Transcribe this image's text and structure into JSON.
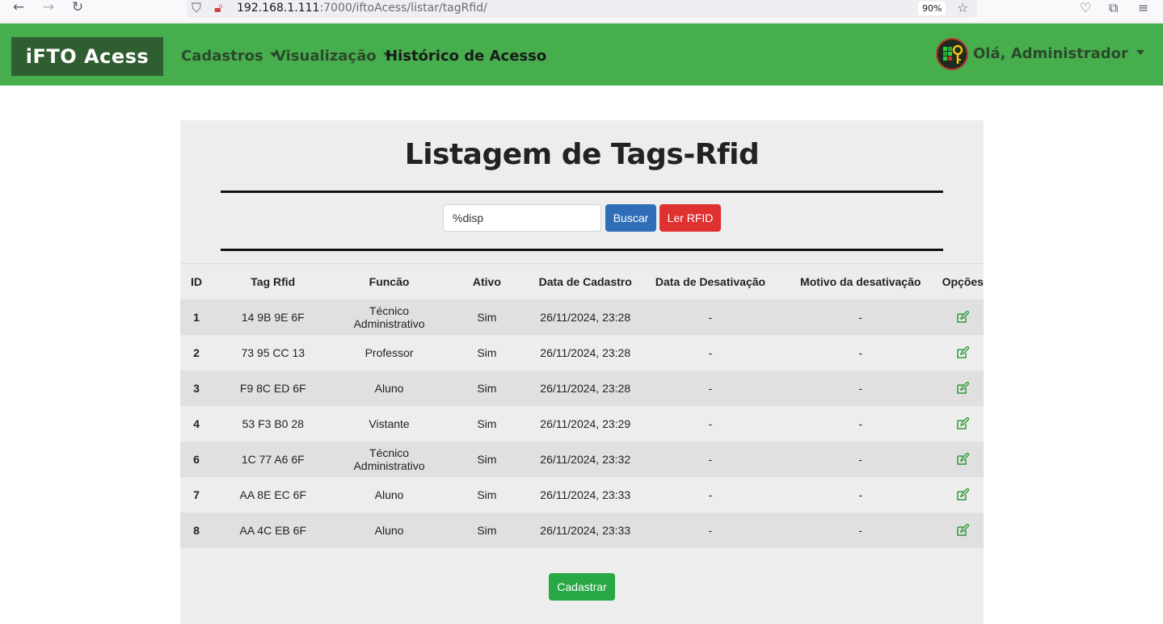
{
  "browser": {
    "url_host": "192.168.1.111",
    "url_rest": ":7000/iftoAcess/listar/tagRfid/",
    "zoom": "90%",
    "icons": [
      "back-arrow-icon",
      "forward-arrow-icon",
      "reload-icon",
      "shield-icon",
      "lock-slash-icon",
      "star-icon",
      "pocket-icon",
      "extensions-icon",
      "menu-icon"
    ]
  },
  "navbar": {
    "brand": "iFTO Acess",
    "links": [
      {
        "label": "Cadastros",
        "dropdown": true
      },
      {
        "label": "Visualização",
        "dropdown": true
      },
      {
        "label": "Histórico de Acesso",
        "dropdown": false
      }
    ],
    "user_greeting": "Olá, Administrador",
    "color": "#47ae4d"
  },
  "main": {
    "title": "Listagem de Tags-Rfid",
    "search": {
      "value": "%disp"
    },
    "search_button": "Buscar",
    "read_button": "Ler RFID",
    "create_button": "Cadastrar",
    "columns": [
      "ID",
      "Tag Rfid",
      "Funcão",
      "Ativo",
      "Data de Cadastro",
      "Data de Desativação",
      "Motivo da desativação",
      "Opções"
    ],
    "rows": [
      {
        "id": "1",
        "tag": "14 9B 9E 6F",
        "funcao": "Técnico Administrativo",
        "ativo": "Sim",
        "cadastro": "26/11/2024, 23:28",
        "desativacao": "-",
        "motivo": "-"
      },
      {
        "id": "2",
        "tag": "73 95 CC 13",
        "funcao": "Professor",
        "ativo": "Sim",
        "cadastro": "26/11/2024, 23:28",
        "desativacao": "-",
        "motivo": "-"
      },
      {
        "id": "3",
        "tag": "F9 8C ED 6F",
        "funcao": "Aluno",
        "ativo": "Sim",
        "cadastro": "26/11/2024, 23:28",
        "desativacao": "-",
        "motivo": "-"
      },
      {
        "id": "4",
        "tag": "53 F3 B0 28",
        "funcao": "Vistante",
        "ativo": "Sim",
        "cadastro": "26/11/2024, 23:29",
        "desativacao": "-",
        "motivo": "-"
      },
      {
        "id": "6",
        "tag": "1C 77 A6 6F",
        "funcao": "Técnico Administrativo",
        "ativo": "Sim",
        "cadastro": "26/11/2024, 23:32",
        "desativacao": "-",
        "motivo": "-"
      },
      {
        "id": "7",
        "tag": "AA 8E EC 6F",
        "funcao": "Aluno",
        "ativo": "Sim",
        "cadastro": "26/11/2024, 23:33",
        "desativacao": "-",
        "motivo": "-"
      },
      {
        "id": "8",
        "tag": "AA 4C EB 6F",
        "funcao": "Aluno",
        "ativo": "Sim",
        "cadastro": "26/11/2024, 23:33",
        "desativacao": "-",
        "motivo": "-"
      }
    ]
  }
}
